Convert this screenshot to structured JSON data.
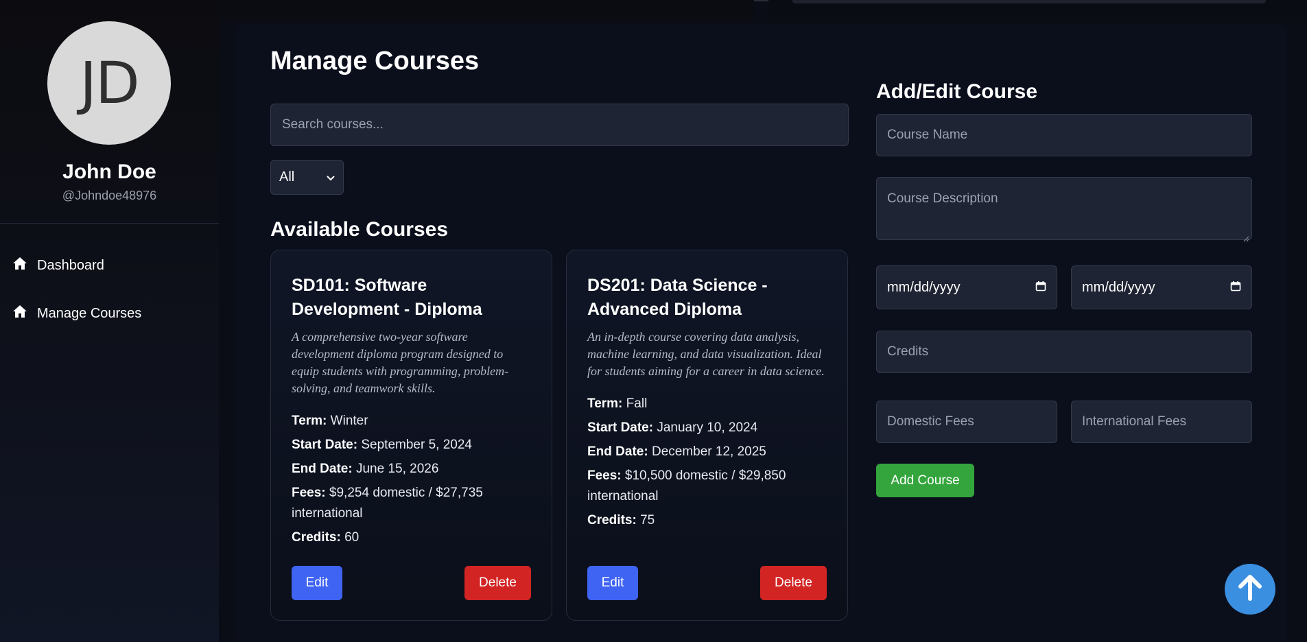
{
  "user": {
    "initials": "JD",
    "name": "John Doe",
    "handle": "@Johndoe48976"
  },
  "sidebar": {
    "items": [
      {
        "label": "Dashboard",
        "icon": "home-icon"
      },
      {
        "label": "Manage Courses",
        "icon": "home-icon"
      }
    ]
  },
  "main": {
    "title": "Manage Courses",
    "search": {
      "placeholder": "Search courses...",
      "value": ""
    },
    "filter": {
      "selected": "All"
    },
    "section_title": "Available Courses"
  },
  "labels": {
    "term": "Term:",
    "start_date": "Start Date:",
    "end_date": "End Date:",
    "fees": "Fees:",
    "credits": "Credits:",
    "edit": "Edit",
    "delete": "Delete"
  },
  "courses": [
    {
      "title": "SD101: Software Development - Diploma",
      "description": "A comprehensive two-year software development diploma program designed to equip students with programming, problem-solving, and teamwork skills.",
      "term": "Winter",
      "start_date": "September 5, 2024",
      "end_date": "June 15, 2026",
      "fees": "$9,254 domestic / $27,735 international",
      "credits": "60"
    },
    {
      "title": "DS201: Data Science - Advanced Diploma",
      "description": "An in-depth course covering data analysis, machine learning, and data visualization. Ideal for students aiming for a career in data science.",
      "term": "Fall",
      "start_date": "January 10, 2024",
      "end_date": "December 12, 2025",
      "fees": "$10,500 domestic / $29,850 international",
      "credits": "75"
    }
  ],
  "form": {
    "title": "Add/Edit Course",
    "course_name_placeholder": "Course Name",
    "course_description_placeholder": "Course Description",
    "start_date_placeholder": "mm/dd/yyyy",
    "end_date_placeholder": "mm/dd/yyyy",
    "credits_placeholder": "Credits",
    "domestic_fees_placeholder": "Domestic Fees",
    "international_fees_placeholder": "International Fees",
    "submit_label": "Add Course"
  },
  "colors": {
    "accent_blue": "#3f63f2",
    "danger_red": "#d32424",
    "success_green": "#33a53c",
    "scroll_top_blue": "#3b8fe0"
  }
}
